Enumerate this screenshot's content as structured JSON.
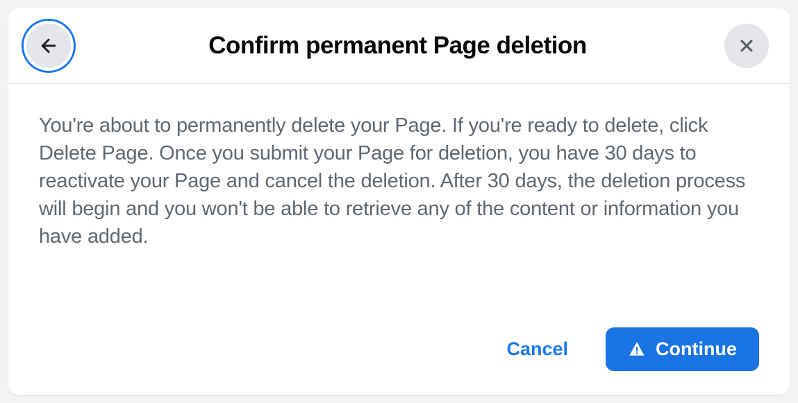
{
  "dialog": {
    "title": "Confirm permanent Page deletion",
    "body": "You're about to permanently delete your Page. If you're ready to delete, click Delete Page. Once you submit your Page for deletion, you have 30 days to reactivate your Page and cancel the deletion. After 30 days, the deletion process will begin and you won't be able to retrieve any of the content or information you have added.",
    "footer": {
      "cancel_label": "Cancel",
      "continue_label": "Continue"
    }
  }
}
